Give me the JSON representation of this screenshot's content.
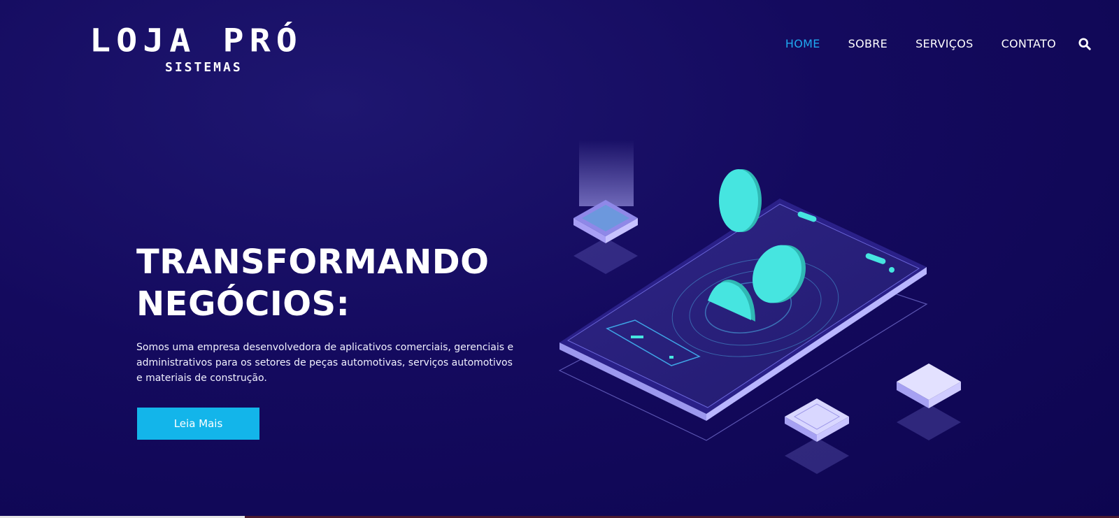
{
  "logo": {
    "main": "LOJA PRÓ",
    "sub": "SISTEMAS"
  },
  "nav": {
    "items": [
      {
        "label": "HOME",
        "active": true
      },
      {
        "label": "SOBRE",
        "active": false
      },
      {
        "label": "SERVIÇOS",
        "active": false
      },
      {
        "label": "CONTATO",
        "active": false
      }
    ],
    "search_icon": "search-icon"
  },
  "hero": {
    "title_line1": "TRANSFORMANDO",
    "title_line2": "NEGÓCIOS:",
    "text": "Somos uma empresa desenvolvedora de aplicativos comerciais, gerenciais e administrativos para os setores de peças automotivas, serviços automotivos e materiais de construção.",
    "button": "Leia Mais"
  },
  "colors": {
    "background": "#140a5e",
    "accent": "#1fa8f0",
    "button": "#13b5ea",
    "coin": "#46e5e0",
    "phone": "#2b2180"
  }
}
